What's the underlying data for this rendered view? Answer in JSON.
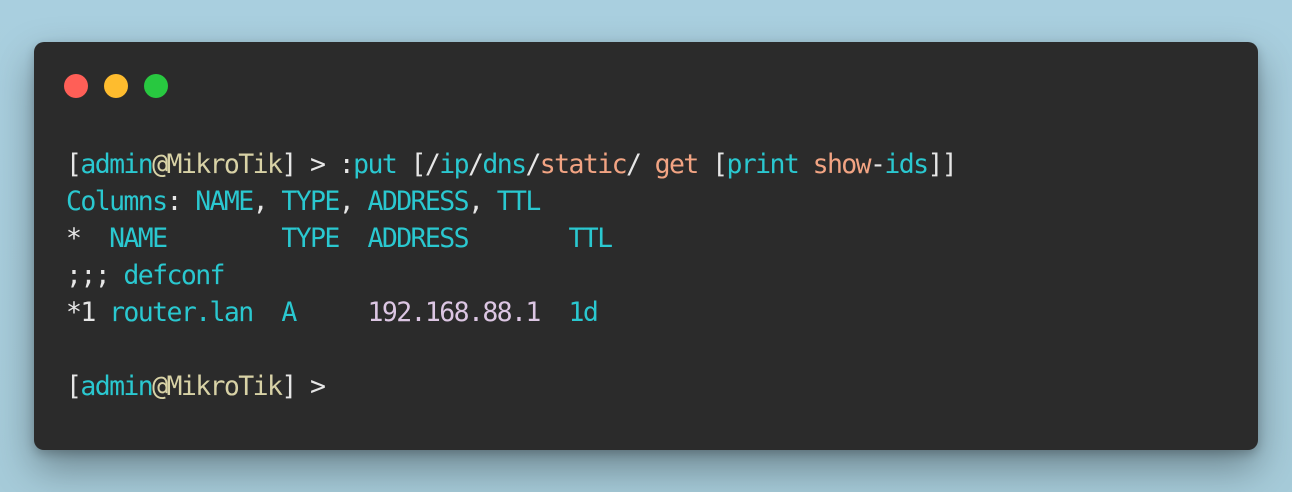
{
  "window": {
    "controls": [
      {
        "name": "close",
        "color": "#ff5f57"
      },
      {
        "name": "minimize",
        "color": "#febc2e"
      },
      {
        "name": "zoom",
        "color": "#28c840"
      }
    ]
  },
  "colors": {
    "window_background": "#2b2b2b",
    "page_background": "#a9cfdf",
    "text_default": "#e6e6e6",
    "cyan": "#2ac8d0",
    "beige": "#d8d2a6",
    "orange": "#f2a483",
    "lilac": "#dcc6e3"
  },
  "terminal": {
    "lines": [
      [
        {
          "t": "[",
          "c": "white"
        },
        {
          "t": "admin",
          "c": "cyan"
        },
        {
          "t": "@MikroTik",
          "c": "beige"
        },
        {
          "t": "] > :",
          "c": "white"
        },
        {
          "t": "put",
          "c": "cyan"
        },
        {
          "t": " [/",
          "c": "white"
        },
        {
          "t": "ip",
          "c": "cyan"
        },
        {
          "t": "/",
          "c": "white"
        },
        {
          "t": "dns",
          "c": "cyan"
        },
        {
          "t": "/",
          "c": "white"
        },
        {
          "t": "static",
          "c": "orange"
        },
        {
          "t": "/ ",
          "c": "white"
        },
        {
          "t": "get",
          "c": "orange"
        },
        {
          "t": " [",
          "c": "white"
        },
        {
          "t": "print",
          "c": "cyan"
        },
        {
          "t": " ",
          "c": "white"
        },
        {
          "t": "show",
          "c": "orange"
        },
        {
          "t": "-",
          "c": "white"
        },
        {
          "t": "ids",
          "c": "cyan"
        },
        {
          "t": "]]",
          "c": "white"
        }
      ],
      [
        {
          "t": "Columns",
          "c": "cyan"
        },
        {
          "t": ": ",
          "c": "white"
        },
        {
          "t": "NAME",
          "c": "cyan"
        },
        {
          "t": ", ",
          "c": "white"
        },
        {
          "t": "TYPE",
          "c": "cyan"
        },
        {
          "t": ", ",
          "c": "white"
        },
        {
          "t": "ADDRESS",
          "c": "cyan"
        },
        {
          "t": ", ",
          "c": "white"
        },
        {
          "t": "TTL",
          "c": "cyan"
        }
      ],
      [
        {
          "t": "*  ",
          "c": "white"
        },
        {
          "t": "NAME",
          "c": "cyan"
        },
        {
          "t": "        ",
          "c": "white"
        },
        {
          "t": "TYPE",
          "c": "cyan"
        },
        {
          "t": "  ",
          "c": "white"
        },
        {
          "t": "ADDRESS",
          "c": "cyan"
        },
        {
          "t": "       ",
          "c": "white"
        },
        {
          "t": "TTL",
          "c": "cyan"
        }
      ],
      [
        {
          "t": ";;; ",
          "c": "white"
        },
        {
          "t": "defconf",
          "c": "cyan"
        }
      ],
      [
        {
          "t": "*1 ",
          "c": "white"
        },
        {
          "t": "router.lan",
          "c": "cyan"
        },
        {
          "t": "  ",
          "c": "white"
        },
        {
          "t": "A",
          "c": "cyan"
        },
        {
          "t": "     ",
          "c": "white"
        },
        {
          "t": "192.168.88.1",
          "c": "lilac"
        },
        {
          "t": "  ",
          "c": "white"
        },
        {
          "t": "1d",
          "c": "cyan"
        }
      ],
      [],
      [
        {
          "t": "[",
          "c": "white"
        },
        {
          "t": "admin",
          "c": "cyan"
        },
        {
          "t": "@MikroTik",
          "c": "beige"
        },
        {
          "t": "] >",
          "c": "white"
        }
      ]
    ]
  }
}
